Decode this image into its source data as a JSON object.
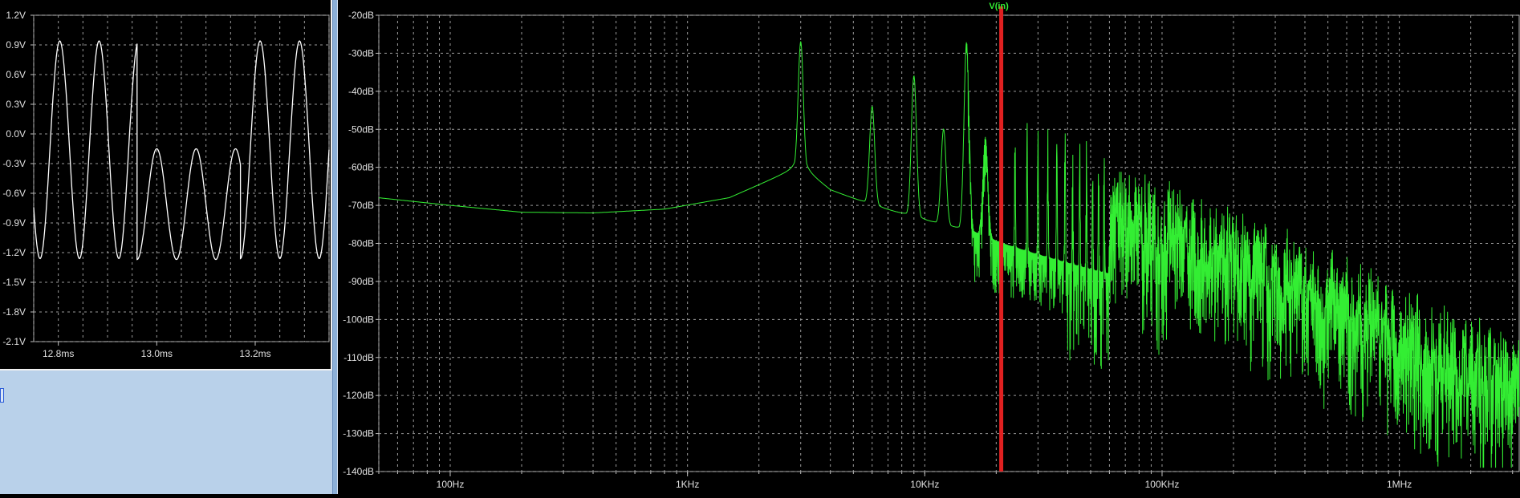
{
  "chart_data": [
    {
      "type": "line",
      "xlabel": "",
      "ylabel": "",
      "xlim": [
        12.75,
        13.35
      ],
      "ylim": [
        -2.1,
        1.2
      ],
      "x_ticks": [
        "12.8ms",
        "13.0ms",
        "13.2ms"
      ],
      "y_ticks": [
        "1.2V",
        "0.9V",
        "0.6V",
        "0.3V",
        "0.0V",
        "-0.3V",
        "-0.6V",
        "-0.9V",
        "-1.2V",
        "-1.5V",
        "-1.8V",
        "-2.1V"
      ],
      "grid": true,
      "color": "#ffffff",
      "series": [
        {
          "x_unit": "ms",
          "y_unit": "V",
          "segments": [
            {
              "x_start": 12.75,
              "x_end": 12.96,
              "offset": -0.16,
              "amplitude": 1.1,
              "period": 0.08,
              "phase_at_start": 3.7
            },
            {
              "x_start": 12.96,
              "x_end": 13.17,
              "offset": -0.71,
              "amplitude": 0.56,
              "period": 0.08,
              "phase_at_start": -1.5708
            },
            {
              "x_start": 13.17,
              "x_end": 13.35,
              "offset": -0.16,
              "amplitude": 1.1,
              "period": 0.08,
              "phase_at_start": -1.5708
            }
          ]
        }
      ]
    },
    {
      "type": "line",
      "xlabel": "",
      "ylabel": "",
      "x_scale": "log",
      "xlim": [
        50,
        3200000
      ],
      "ylim": [
        -140,
        -20
      ],
      "x_ticks": [
        "100Hz",
        "1KHz",
        "10KHz",
        "100KHz",
        "1MHz"
      ],
      "y_ticks": [
        "-20dB",
        "-30dB",
        "-40dB",
        "-50dB",
        "-60dB",
        "-70dB",
        "-80dB",
        "-90dB",
        "-100dB",
        "-110dB",
        "-120dB",
        "-130dB",
        "-140dB"
      ],
      "grid": true,
      "color": "#33ee33",
      "cursor": {
        "x": 21000,
        "color": "#e02020"
      },
      "series": [
        {
          "name": "V(in)",
          "x_unit": "Hz",
          "y_unit": "dB",
          "baseline": [
            [
              50,
              -68
            ],
            [
              100,
              -70
            ],
            [
              200,
              -71.8
            ],
            [
              400,
              -72
            ],
            [
              800,
              -71
            ],
            [
              1500,
              -68
            ],
            [
              2500,
              -62
            ],
            [
              3000,
              -60
            ],
            [
              4000,
              -66
            ],
            [
              6000,
              -70
            ],
            [
              10000,
              -74
            ],
            [
              15000,
              -77
            ],
            [
              21000,
              -80
            ],
            [
              30000,
              -83
            ],
            [
              50000,
              -87
            ],
            [
              100000,
              -92
            ],
            [
              200000,
              -100
            ],
            [
              400000,
              -108
            ],
            [
              700000,
              -115
            ],
            [
              1000000,
              -120
            ],
            [
              1500000,
              -125
            ],
            [
              2000000,
              -128
            ],
            [
              3200000,
              -132
            ]
          ],
          "peaks": [
            [
              3000,
              -27
            ],
            [
              6000,
              -44
            ],
            [
              9000,
              -36
            ],
            [
              12000,
              -50
            ],
            [
              15000,
              -27
            ],
            [
              18000,
              -52
            ],
            [
              21000,
              -48
            ],
            [
              24000,
              -50
            ],
            [
              27000,
              -48
            ],
            [
              30000,
              -50
            ],
            [
              33000,
              -50
            ],
            [
              36000,
              -52
            ],
            [
              39000,
              -48
            ],
            [
              42000,
              -55
            ],
            [
              45000,
              -53
            ],
            [
              48000,
              -53
            ],
            [
              51000,
              -60
            ],
            [
              54000,
              -58
            ],
            [
              57000,
              -55
            ]
          ]
        }
      ]
    }
  ]
}
